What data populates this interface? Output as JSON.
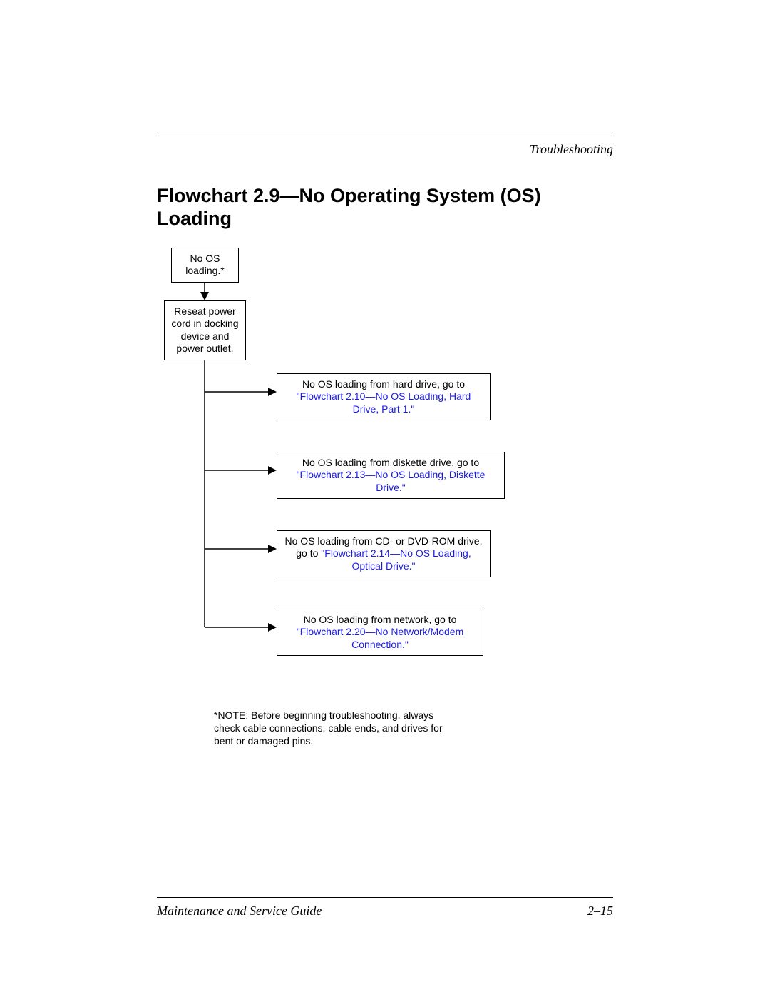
{
  "header": {
    "section": "Troubleshooting"
  },
  "title": "Flowchart 2.9—No Operating System (OS) Loading",
  "nodes": {
    "start": "No OS loading.*",
    "reseat": "Reseat power cord in docking device and power outlet.",
    "hd_text": "No OS loading from hard drive, go to ",
    "hd_link": "\"Flowchart 2.10—No OS Loading, Hard Drive, Part 1.\"",
    "dd_text": "No OS loading from diskette drive, go to ",
    "dd_link": "\"Flowchart 2.13—No OS Loading, Diskette Drive.\"",
    "cd_text": "No OS loading from CD- or DVD-ROM drive, go to ",
    "cd_link": "\"Flowchart 2.14—No OS Loading, Optical Drive.\"",
    "net_text": "No OS loading from network, go to ",
    "net_link": "\"Flowchart 2.20—No Network/Modem Connection.\""
  },
  "note": "*NOTE: Before beginning troubleshooting, always check cable connections, cable ends, and drives for bent or damaged pins.",
  "footer": {
    "guide": "Maintenance and Service Guide",
    "page": "2–15"
  }
}
